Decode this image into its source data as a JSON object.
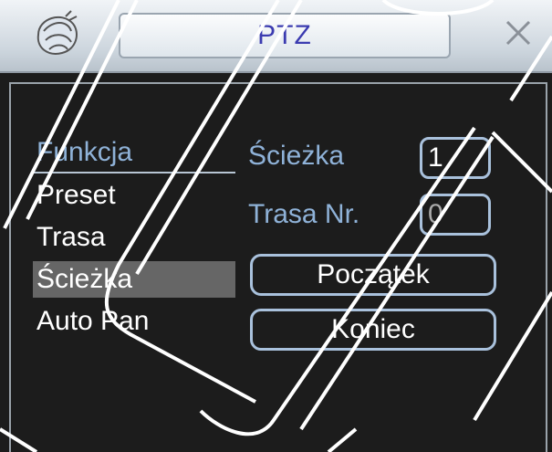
{
  "window": {
    "title": "PTZ",
    "close_icon": "close-x-icon",
    "logo_icon": "shell-logo-icon"
  },
  "menu": {
    "header": "Funkcja",
    "items": [
      {
        "label": "Preset",
        "selected": false
      },
      {
        "label": "Trasa",
        "selected": false
      },
      {
        "label": "Ścieżka",
        "selected": true
      },
      {
        "label": "Auto Pan",
        "selected": false
      }
    ]
  },
  "form": {
    "sciezka_label": "Ścieżka",
    "sciezka_value": "1",
    "trasa_label": "Trasa Nr.",
    "trasa_value": "0",
    "start_button": "Początek",
    "end_button": "Koniec"
  },
  "colors": {
    "background": "#1c1c1c",
    "label": "#8fb2d8",
    "selected_row": "#666666",
    "title_text": "#3b3bb0",
    "field_border": "#a9c1dc"
  }
}
